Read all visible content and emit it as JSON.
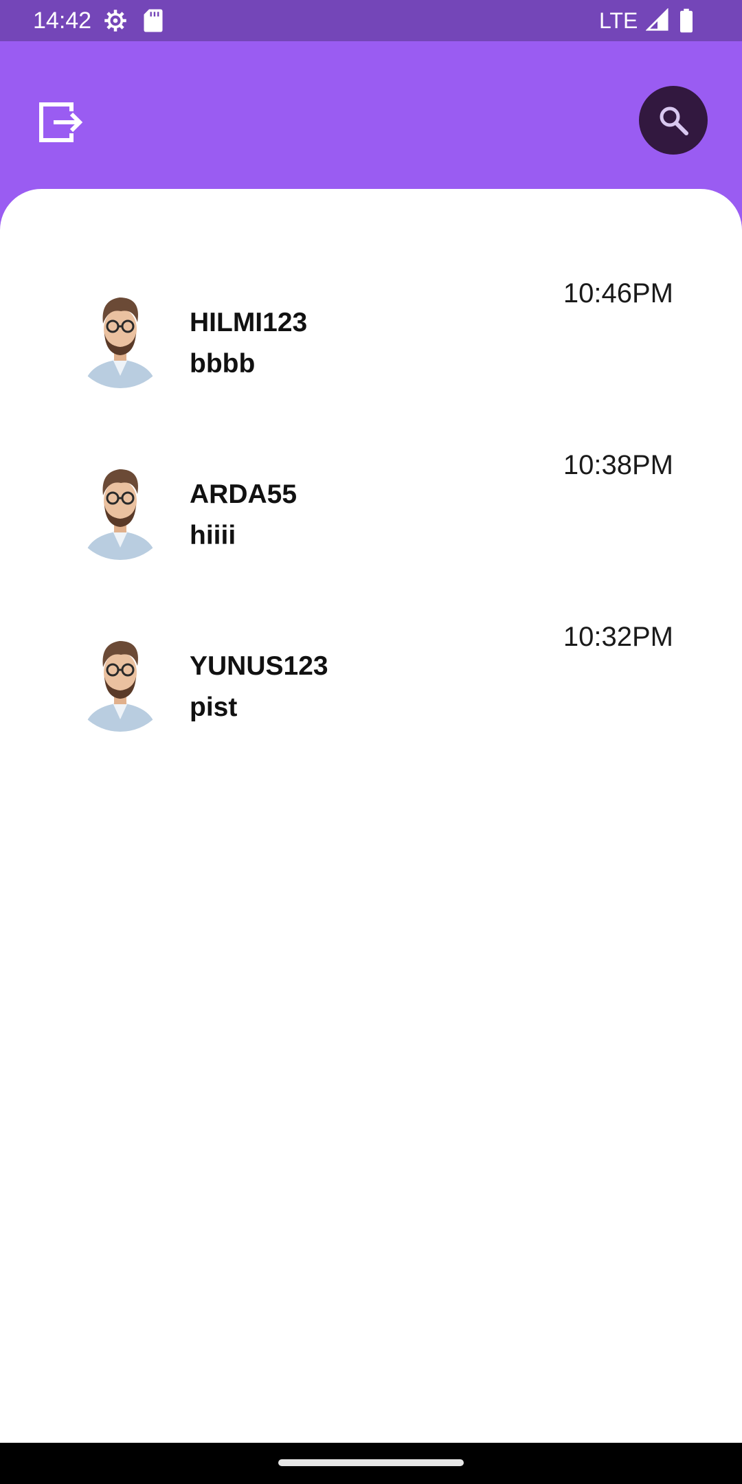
{
  "status_bar": {
    "time": "14:42",
    "network": "LTE",
    "icons": [
      "settings-icon",
      "sd-card-icon",
      "signal-icon",
      "battery-icon"
    ]
  },
  "app_bar": {
    "left_action_icon": "logout-icon",
    "right_action_icon": "search-icon",
    "colors": {
      "background": "#9a5cf2",
      "status_bar": "#7446b8",
      "search_button": "#32183f"
    }
  },
  "chats": [
    {
      "name": "HILMI123",
      "last_message": "bbbb",
      "time": "10:46PM",
      "avatar_icon": "avatar"
    },
    {
      "name": "ARDA55",
      "last_message": "hiiii",
      "time": "10:38PM",
      "avatar_icon": "avatar"
    },
    {
      "name": "YUNUS123",
      "last_message": "pist",
      "time": "10:32PM",
      "avatar_icon": "avatar"
    }
  ]
}
